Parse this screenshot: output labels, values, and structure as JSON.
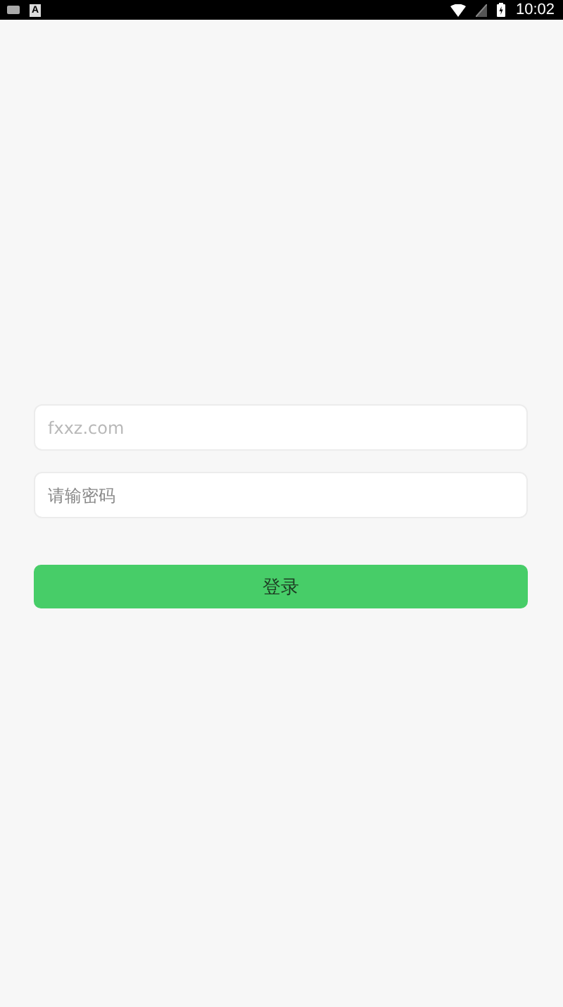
{
  "status_bar": {
    "notification_glyph": "A",
    "time": "10:02"
  },
  "login_form": {
    "fields": [
      {
        "kind": "text",
        "placeholder": "fxxz.com"
      },
      {
        "kind": "password",
        "placeholder": "请输密码"
      }
    ],
    "submit": {
      "label": "登录"
    }
  }
}
